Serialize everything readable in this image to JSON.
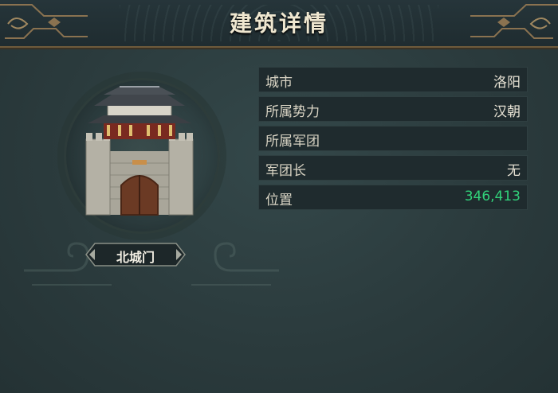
{
  "header": {
    "title": "建筑详情"
  },
  "building": {
    "name": "北城门",
    "icon": "city-gate-icon"
  },
  "info_rows": [
    {
      "label": "城市",
      "value": "洛阳"
    },
    {
      "label": "所属势力",
      "value": "汉朝"
    },
    {
      "label": "所属军团",
      "value": ""
    },
    {
      "label": "军团长",
      "value": "无"
    },
    {
      "label": "位置",
      "value": "346,413"
    }
  ],
  "colors": {
    "position_value": "#31d27a",
    "header_trim": "#6e5a3c",
    "panel_bg": "#2b3b3d"
  }
}
